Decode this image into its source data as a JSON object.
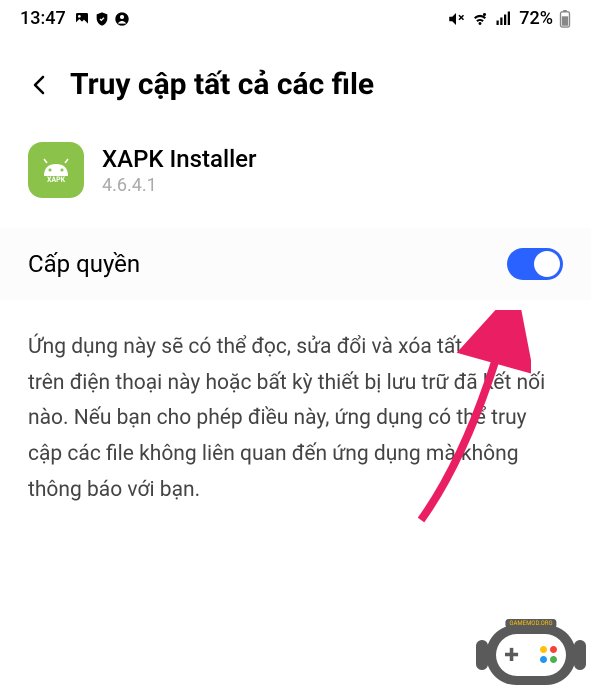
{
  "statusBar": {
    "time": "13:47",
    "battery": "72%"
  },
  "header": {
    "title": "Truy cập tất cả các file"
  },
  "app": {
    "name": "XAPK Installer",
    "version": "4.6.4.1",
    "iconLabel": "XAPK"
  },
  "permission": {
    "label": "Cấp quyền",
    "enabled": true
  },
  "description": "Ứng dụng này sẽ có thể đọc, sửa đổi và xóa tất cả file trên điện thoại này hoặc bất kỳ thiết bị lưu trữ đã kết nối nào. Nếu bạn cho phép điều này, ứng dụng có thể truy cập các file không liên quan đến ứng dụng mà không thông báo với bạn.",
  "logo": {
    "text": "GAMEMOD.ORG"
  }
}
